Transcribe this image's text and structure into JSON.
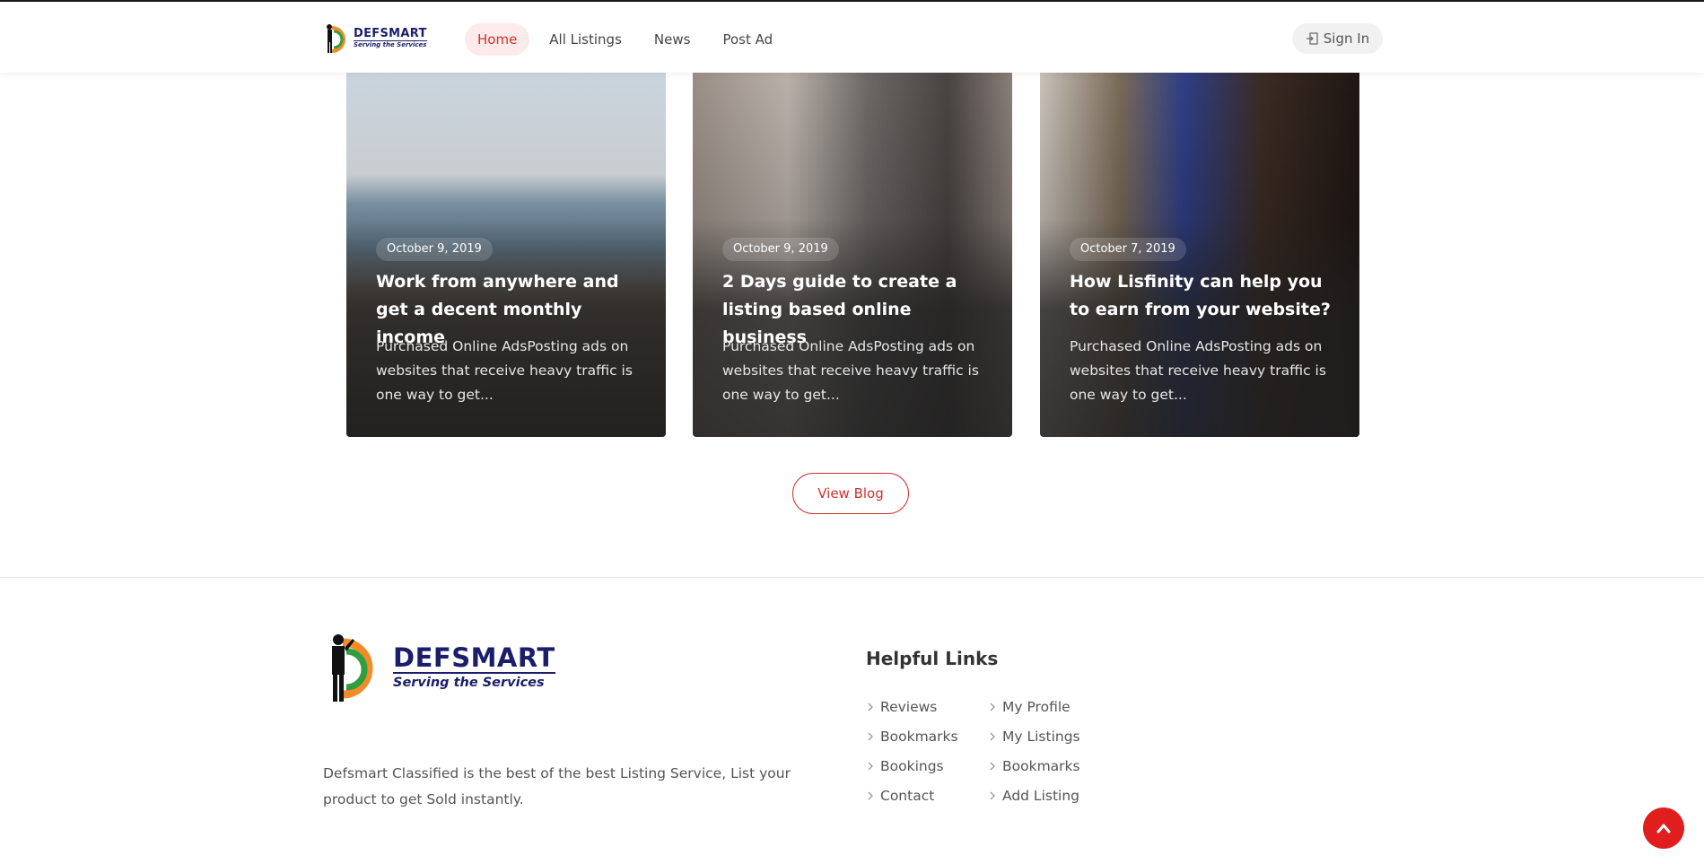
{
  "header": {
    "logo": {
      "name": "DEFSMART",
      "tagline": "Serving the Services"
    },
    "nav": [
      {
        "label": "Home",
        "active": true
      },
      {
        "label": "All Listings",
        "active": false
      },
      {
        "label": "News",
        "active": false
      },
      {
        "label": "Post Ad",
        "active": false
      }
    ],
    "signin_label": "Sign In"
  },
  "blog": {
    "posts": [
      {
        "date": "October 9, 2019",
        "title": "Work from anywhere and get a decent monthly income",
        "excerpt": "Purchased Online AdsPosting ads on websites that receive heavy traffic is one way to get..."
      },
      {
        "date": "October 9, 2019",
        "title": "2 Days guide to create a listing based online business",
        "excerpt": "Purchased Online AdsPosting ads on websites that receive heavy traffic is one way to get..."
      },
      {
        "date": "October 7, 2019",
        "title": "How Lisfinity can help you to earn from your website?",
        "excerpt": "Purchased Online AdsPosting ads on websites that receive heavy traffic is one way to get..."
      }
    ],
    "view_blog_label": "View Blog"
  },
  "footer": {
    "logo": {
      "name": "DEFSMART",
      "tagline": "Serving the Services"
    },
    "description": "Defsmart Classified is the best of the best Listing Service, List your product to get Sold instantly.",
    "helpful_links_heading": "Helpful Links",
    "links_col1": [
      "Reviews",
      "Bookmarks",
      "Bookings",
      "Contact"
    ],
    "links_col2": [
      "My Profile",
      "My Listings",
      "Bookmarks",
      "Add Listing"
    ]
  },
  "colors": {
    "accent": "#d0312d",
    "brand_navy": "#1b1f6b",
    "to_top_bg": "#e01e1e"
  },
  "icons": {
    "signin": "sign-in-icon",
    "link_bullet": "chevron-right-icon",
    "to_top": "chevron-up-icon"
  }
}
